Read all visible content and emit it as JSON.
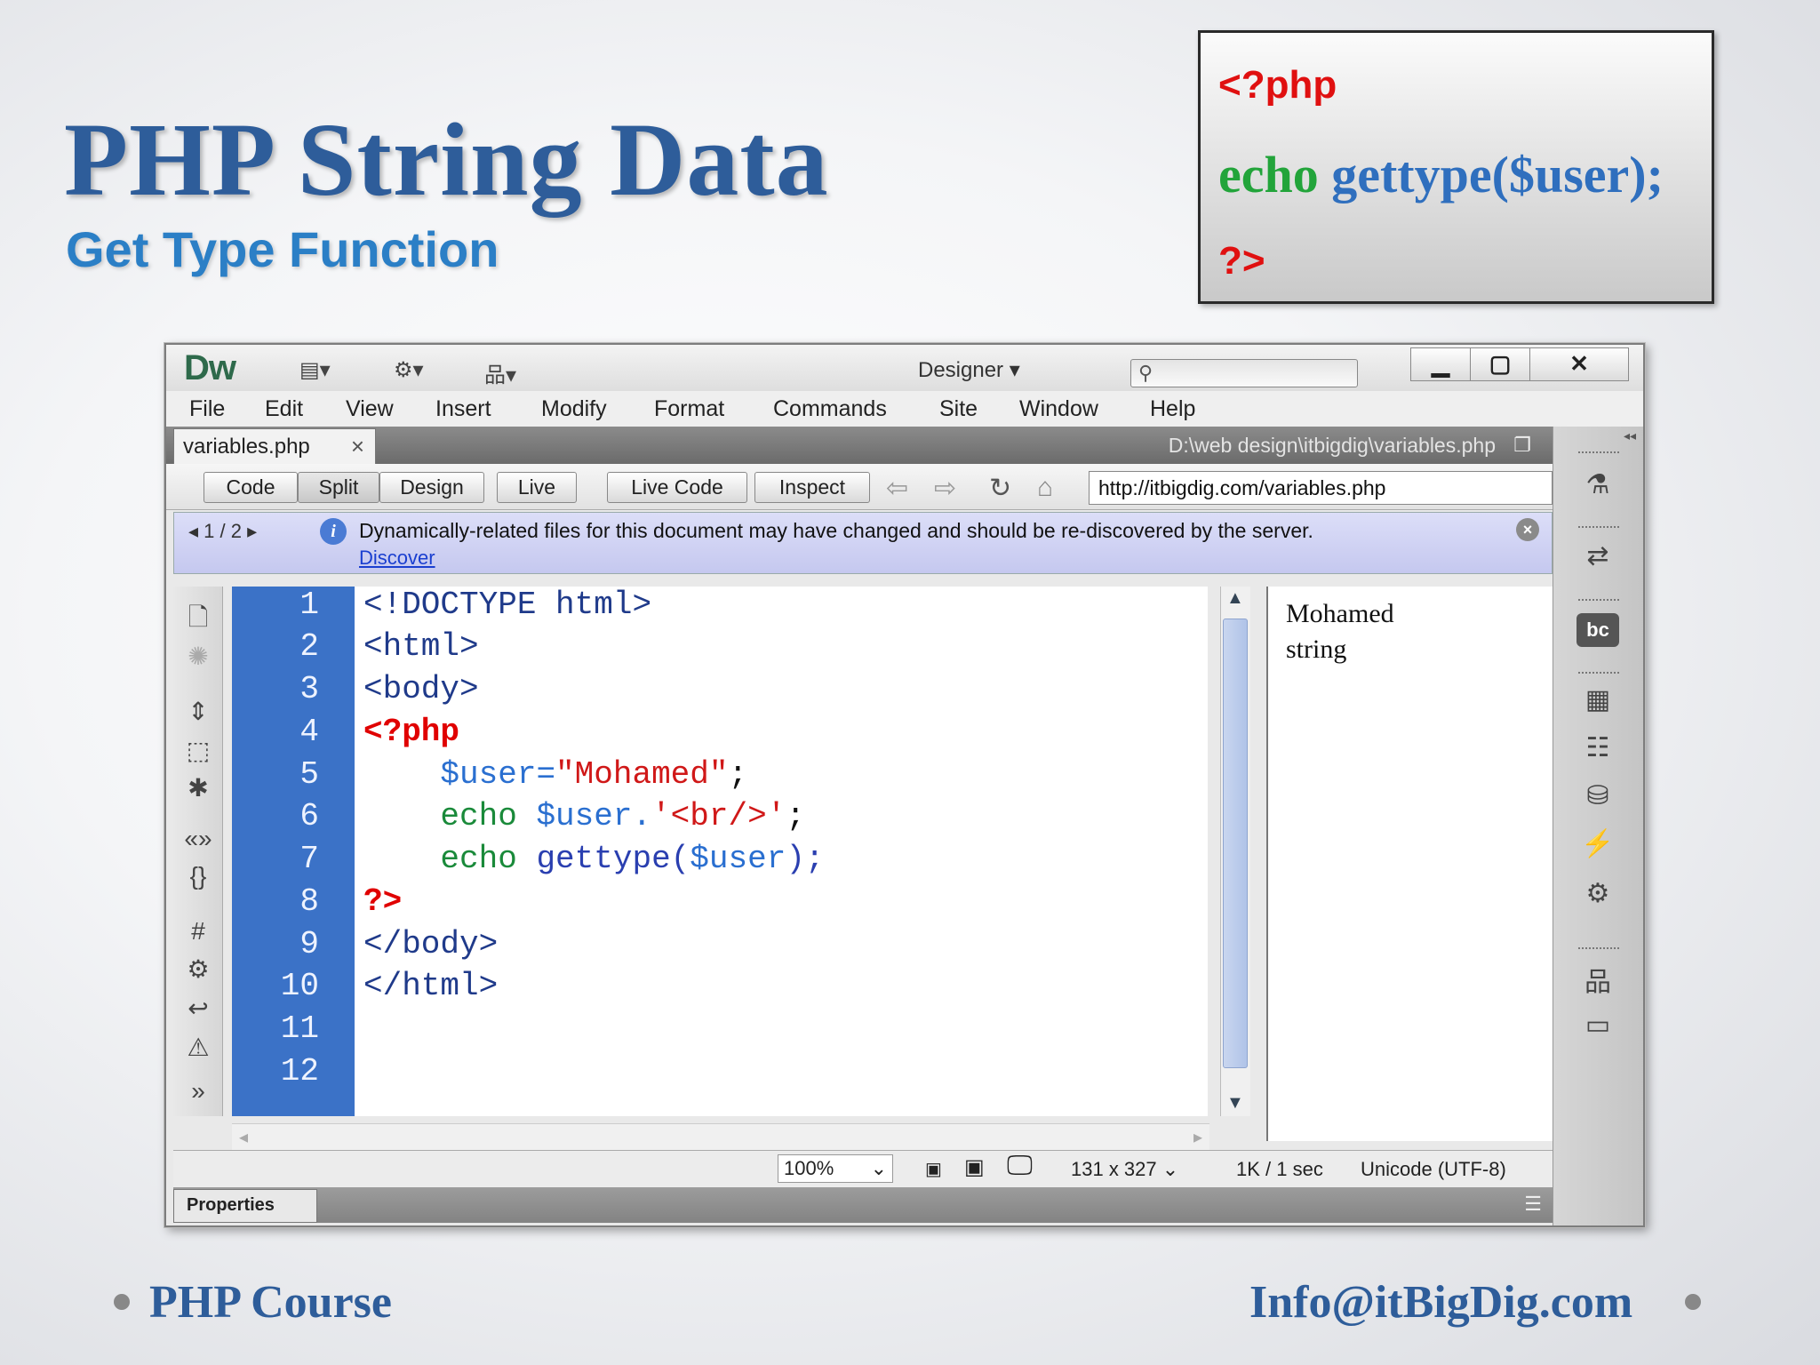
{
  "slide": {
    "title": "PHP String Data",
    "subtitle": "Get Type Function",
    "snippet": {
      "line1": "<?php",
      "echo": "echo",
      "fn": "gettype(",
      "var": "$user);",
      "line3": "?>"
    },
    "footer_left": "PHP Course",
    "footer_right": "Info@itBigDig.com"
  },
  "app": {
    "logo": "Dw",
    "workspace": "Designer",
    "menu": [
      "File",
      "Edit",
      "View",
      "Insert",
      "Modify",
      "Format",
      "Commands",
      "Site",
      "Window",
      "Help"
    ],
    "tab": {
      "name": "variables.php",
      "close": "×"
    },
    "doc_path": "D:\\web design\\itbigdig\\variables.php",
    "view_buttons": {
      "code": "Code",
      "split": "Split",
      "design": "Design",
      "live": "Live",
      "live_code": "Live Code",
      "inspect": "Inspect"
    },
    "url": "http://itbigdig.com/variables.php",
    "info": {
      "page": "1 / 2",
      "message": "Dynamically-related files for this document may have changed and should be re-discovered by the server.",
      "link": "Discover"
    },
    "line_numbers": [
      "1",
      "2",
      "3",
      "4",
      "5",
      "6",
      "7",
      "8",
      "9",
      "10",
      "11",
      "12"
    ],
    "code": {
      "l1": "<!DOCTYPE html>",
      "l2": "<html>",
      "l3": "<body>",
      "l4": "<?php",
      "l5a": "$user=",
      "l5b": "\"Mohamed\"",
      "l5c": ";",
      "l6a": "echo",
      "l6b": "$user.",
      "l6c": "'<br/>'",
      "l6d": ";",
      "l7a": "echo",
      "l7b": "gettype(",
      "l7c": "$user",
      "l7d": ");",
      "l8": "?>",
      "l9": "</body>",
      "l10": "</html>"
    },
    "live_output": [
      "Mohamed",
      "string"
    ],
    "status": {
      "zoom": "100%",
      "size": "131 x 327",
      "speed": "1K / 1 sec",
      "encoding": "Unicode (UTF-8)"
    },
    "properties_label": "Properties"
  },
  "colors": {
    "accent": "#2e5d9a",
    "line_gutter": "#3b72c7",
    "php_tag": "#e00000"
  }
}
